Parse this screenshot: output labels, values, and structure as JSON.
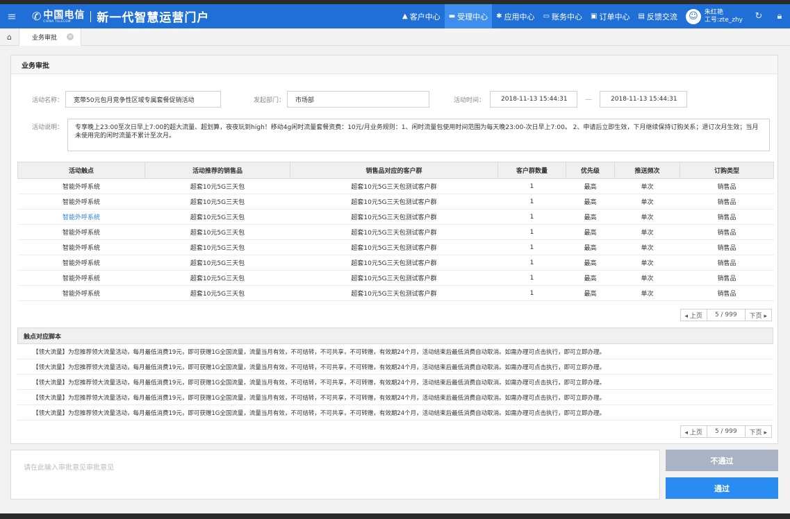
{
  "header": {
    "logo_cn": "中国电信",
    "logo_en": "CHINA TELECOM",
    "portal_title": "新一代智慧运营门户",
    "nav": [
      {
        "icon": "▲",
        "label": "客户中心",
        "active": false
      },
      {
        "icon": "▬",
        "label": "受理中心",
        "active": true
      },
      {
        "icon": "✱",
        "label": "应用中心",
        "active": false
      },
      {
        "icon": "▭",
        "label": "账务中心",
        "active": false
      },
      {
        "icon": "▣",
        "label": "订单中心",
        "active": false
      },
      {
        "icon": "▤",
        "label": "反馈交流",
        "active": false
      }
    ],
    "user_name": "朱红艳",
    "user_id": "工号:zte_zhy"
  },
  "tabs": {
    "current": "业务审批"
  },
  "panel": {
    "title": "业务审批",
    "activity_name_label": "活动名称：",
    "activity_name": "宽带50元包月竞争性区域专属套餐促销活动",
    "dept_label": "发起部门：",
    "dept": "市场部",
    "time_label": "活动时间：",
    "time_start": "2018-11-13 15:44:31",
    "time_sep": "—",
    "time_end": "2018-11-13 15:44:31",
    "desc_label": "活动说明：",
    "desc": "专享晚上23:00至次日早上7:00的超大流量、超划算，夜夜玩到high！移动4g闲时流量套餐资费：10元/月业务规则：1、闲时流量包使用时间范围为每天晚23:00-次日早上7:00。 2、申请后立即生效，下月继续保持订购关系；退订次月生效；当月未使用完的闲时流量不累计至次月。"
  },
  "table": {
    "columns": [
      "活动触点",
      "活动推荐的销售品",
      "销售品对应的客户群",
      "客户群数量",
      "优先级",
      "推送频次",
      "订购类型"
    ],
    "rows": [
      {
        "touch": "智能外呼系统",
        "product": "超套10元5G三天包",
        "group": "超套10元5G三天包测试客户群",
        "count": "1",
        "priority": "最高",
        "freq": "单次",
        "type": "销售品",
        "link": false
      },
      {
        "touch": "智能外呼系统",
        "product": "超套10元5G三天包",
        "group": "超套10元5G三天包测试客户群",
        "count": "1",
        "priority": "最高",
        "freq": "单次",
        "type": "销售品",
        "link": false
      },
      {
        "touch": "智能外呼系统",
        "product": "超套10元5G三天包",
        "group": "超套10元5G三天包测试客户群",
        "count": "1",
        "priority": "最高",
        "freq": "单次",
        "type": "销售品",
        "link": true
      },
      {
        "touch": "智能外呼系统",
        "product": "超套10元5G三天包",
        "group": "超套10元5G三天包测试客户群",
        "count": "1",
        "priority": "最高",
        "freq": "单次",
        "type": "销售品",
        "link": false
      },
      {
        "touch": "智能外呼系统",
        "product": "超套10元5G三天包",
        "group": "超套10元5G三天包测试客户群",
        "count": "1",
        "priority": "最高",
        "freq": "单次",
        "type": "销售品",
        "link": false
      },
      {
        "touch": "智能外呼系统",
        "product": "超套10元5G三天包",
        "group": "超套10元5G三天包测试客户群",
        "count": "1",
        "priority": "最高",
        "freq": "单次",
        "type": "销售品",
        "link": false
      },
      {
        "touch": "智能外呼系统",
        "product": "超套10元5G三天包",
        "group": "超套10元5G三天包测试客户群",
        "count": "1",
        "priority": "最高",
        "freq": "单次",
        "type": "销售品",
        "link": false
      },
      {
        "touch": "智能外呼系统",
        "product": "超套10元5G三天包",
        "group": "超套10元5G三天包测试客户群",
        "count": "1",
        "priority": "最高",
        "freq": "单次",
        "type": "销售品",
        "link": false
      }
    ]
  },
  "pager1": {
    "prev": "◂ 上页",
    "page": "5 / 999",
    "next": "下页 ▸"
  },
  "scripts": {
    "title": "触点对应脚本",
    "lines": [
      "【领大流量】为您推荐领大流量活动，每月最低消费19元，即可获赠1G全国流量，流量当月有效，不可结转，不可共享，不可转赠，有效期24个月，活动结束后最低消费自动取消。如需办理可点击执行，即可立即办理。",
      "【领大流量】为您推荐领大流量活动，每月最低消费19元，即可获赠1G全国流量，流量当月有效，不可结转，不可共享，不可转赠，有效期24个月，活动结束后最低消费自动取消。如需办理可点击执行，即可立即办理。",
      "【领大流量】为您推荐领大流量活动，每月最低消费19元，即可获赠1G全国流量，流量当月有效，不可结转，不可共享，不可转赠，有效期24个月，活动结束后最低消费自动取消。如需办理可点击执行，即可立即办理。",
      "【领大流量】为您推荐领大流量活动，每月最低消费19元，即可获赠1G全国流量，流量当月有效，不可结转，不可共享，不可转赠，有效期24个月，活动结束后最低消费自动取消。如需办理可点击执行，即可立即办理。",
      "【领大流量】为您推荐领大流量活动，每月最低消费19元，即可获赠1G全国流量，流量当月有效，不可结转，不可共享，不可转赠，有效期24个月，活动结束后最低消费自动取消。如需办理可点击执行，即可立即办理。"
    ]
  },
  "pager2": {
    "prev": "◂ 上页",
    "page": "5 / 999",
    "next": "下页 ▸"
  },
  "approval": {
    "placeholder": "请在此输入审批意见审批意见",
    "reject_label": "不通过",
    "approve_label": "通过"
  }
}
